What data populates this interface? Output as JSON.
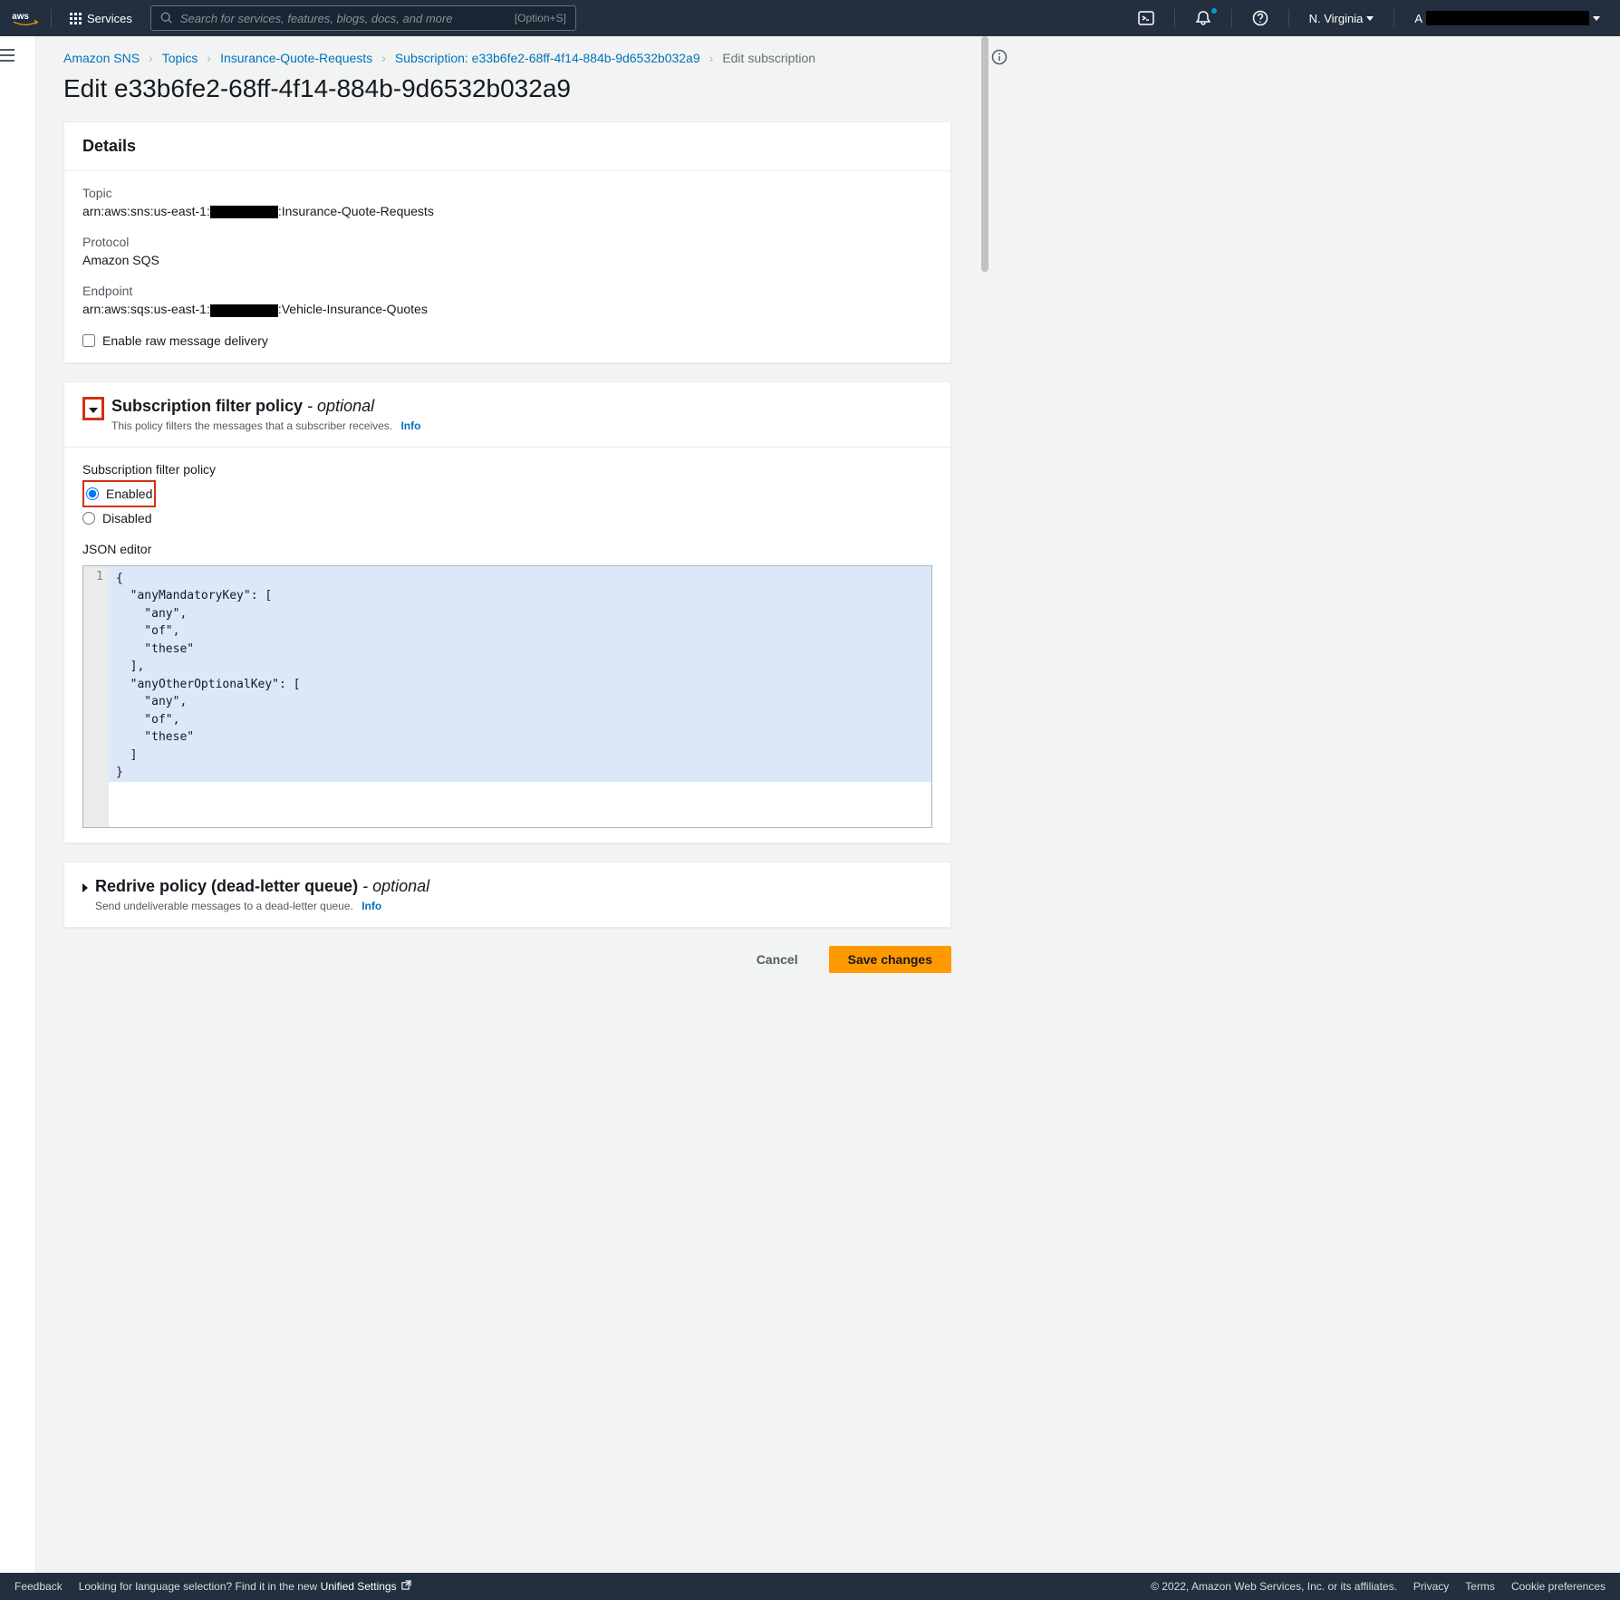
{
  "nav": {
    "services": "Services",
    "search_placeholder": "Search for services, features, blogs, docs, and more",
    "search_shortcut": "[Option+S]",
    "region": "N. Virginia",
    "account_prefix": "A"
  },
  "breadcrumb": {
    "items": [
      "Amazon SNS",
      "Topics",
      "Insurance-Quote-Requests",
      "Subscription: e33b6fe2-68ff-4f14-884b-9d6532b032a9"
    ],
    "current": "Edit subscription"
  },
  "page_title": "Edit e33b6fe2-68ff-4f14-884b-9d6532b032a9",
  "details": {
    "title": "Details",
    "topic_label": "Topic",
    "topic_prefix": "arn:aws:sns:us-east-1:",
    "topic_suffix": ":Insurance-Quote-Requests",
    "protocol_label": "Protocol",
    "protocol_value": "Amazon SQS",
    "endpoint_label": "Endpoint",
    "endpoint_prefix": "arn:aws:sqs:us-east-1:",
    "endpoint_suffix": ":Vehicle-Insurance-Quotes",
    "raw_delivery": "Enable raw message delivery"
  },
  "filter": {
    "title": "Subscription filter policy",
    "optional": "- optional",
    "desc": "This policy filters the messages that a subscriber receives.",
    "info": "Info",
    "policy_label": "Subscription filter policy",
    "enabled": "Enabled",
    "disabled": "Disabled",
    "editor_label": "JSON editor",
    "json": "{\n  \"anyMandatoryKey\": [\n    \"any\",\n    \"of\",\n    \"these\"\n  ],\n  \"anyOtherOptionalKey\": [\n    \"any\",\n    \"of\",\n    \"these\"\n  ]\n}"
  },
  "redrive": {
    "title": "Redrive policy (dead-letter queue)",
    "optional": "- optional",
    "desc": "Send undeliverable messages to a dead-letter queue.",
    "info": "Info"
  },
  "actions": {
    "cancel": "Cancel",
    "save": "Save changes"
  },
  "footer": {
    "feedback": "Feedback",
    "lang_prompt": "Looking for language selection? Find it in the new",
    "unified": "Unified Settings",
    "copyright": "© 2022, Amazon Web Services, Inc. or its affiliates.",
    "privacy": "Privacy",
    "terms": "Terms",
    "cookies": "Cookie preferences"
  }
}
